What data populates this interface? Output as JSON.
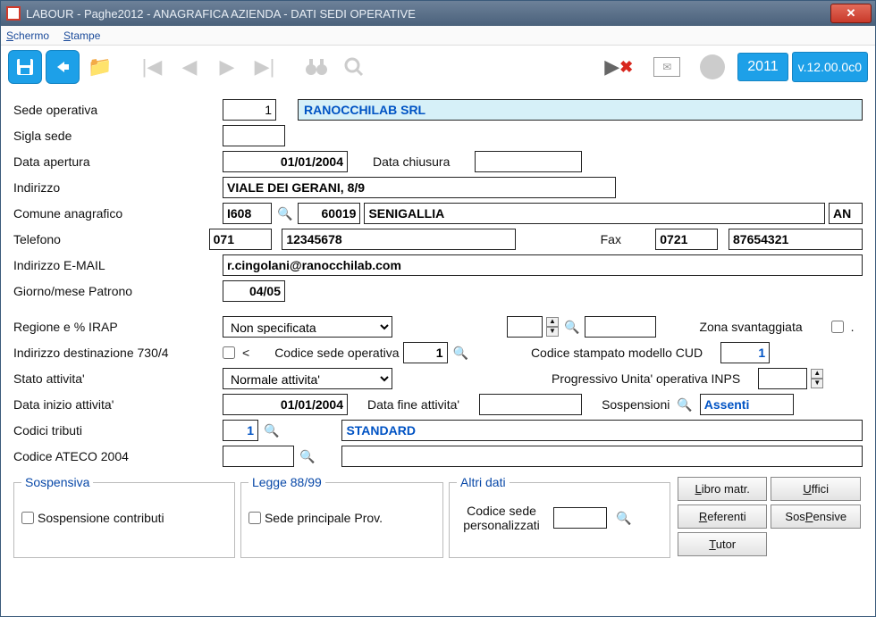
{
  "title": "LABOUR - Paghe2012 - ANAGRAFICA AZIENDA - DATI SEDI OPERATIVE",
  "menu": {
    "schermo": "Schermo",
    "stampe": "Stampe"
  },
  "toolbar": {
    "year": "2011",
    "version": "v.12.00.0c0"
  },
  "labels": {
    "sede_op": "Sede operativa",
    "sigla": "Sigla sede",
    "data_apertura": "Data apertura",
    "data_chiusura": "Data chiusura",
    "indirizzo": "Indirizzo",
    "comune": "Comune anagrafico",
    "telefono": "Telefono",
    "fax": "Fax",
    "email": "Indirizzo E-MAIL",
    "patrono": "Giorno/mese Patrono",
    "regione": "Regione e % IRAP",
    "zona": "Zona svantaggiata",
    "dest730": "Indirizzo destinazione 730/4",
    "cod_sede_op": "Codice sede operativa",
    "cod_cud": "Codice stampato modello CUD",
    "stato": "Stato attivita'",
    "progressivo": "Progressivo Unita' operativa INPS",
    "data_inizio": "Data inizio attivita'",
    "data_fine": "Data fine attivita'",
    "sospensioni": "Sospensioni",
    "codici_tributi": "Codici tributi",
    "ateco": "Codice ATECO 2004",
    "sospensiva_legend": "Sospensiva",
    "sosp_contributi": "Sospensione contributi",
    "legge_legend": "Legge 88/99",
    "sede_principale": "Sede principale Prov.",
    "altri_dati_legend": "Altri dati",
    "codice_pers": "Codice sede personalizzati",
    "lt": "<"
  },
  "values": {
    "sede_num": "1",
    "sede_nome": "RANOCCHILAB SRL",
    "sigla": "",
    "data_apertura": "01/01/2004",
    "data_chiusura": "",
    "indirizzo": "VIALE DEI GERANI, 8/9",
    "comune_cod": "I608",
    "comune_cap": "60019",
    "comune_nome": "SENIGALLIA",
    "comune_prov": "AN",
    "tel_pref": "071",
    "tel_num": "12345678",
    "fax_pref": "0721",
    "fax_num": "87654321",
    "email": "r.cingolani@ranocchilab.com",
    "patrono": "04/05",
    "regione_sel": "Non specificata",
    "irap_pct": "",
    "irap_val": "",
    "cod_sede_op": "1",
    "cod_cud": "1",
    "stato_sel": "Normale attivita'",
    "progressivo": "",
    "data_inizio": "01/01/2004",
    "data_fine": "",
    "sospensioni_val": "Assenti",
    "tributi_cod": "1",
    "tributi_desc": "STANDARD",
    "ateco_cod": "",
    "ateco_desc": "",
    "codice_pers": "",
    "dot": "."
  },
  "buttons": {
    "libro": "Libro matr.",
    "uffici": "Uffici",
    "referenti": "Referenti",
    "sospensive": "SosPensive",
    "tutor": "Tutor"
  }
}
